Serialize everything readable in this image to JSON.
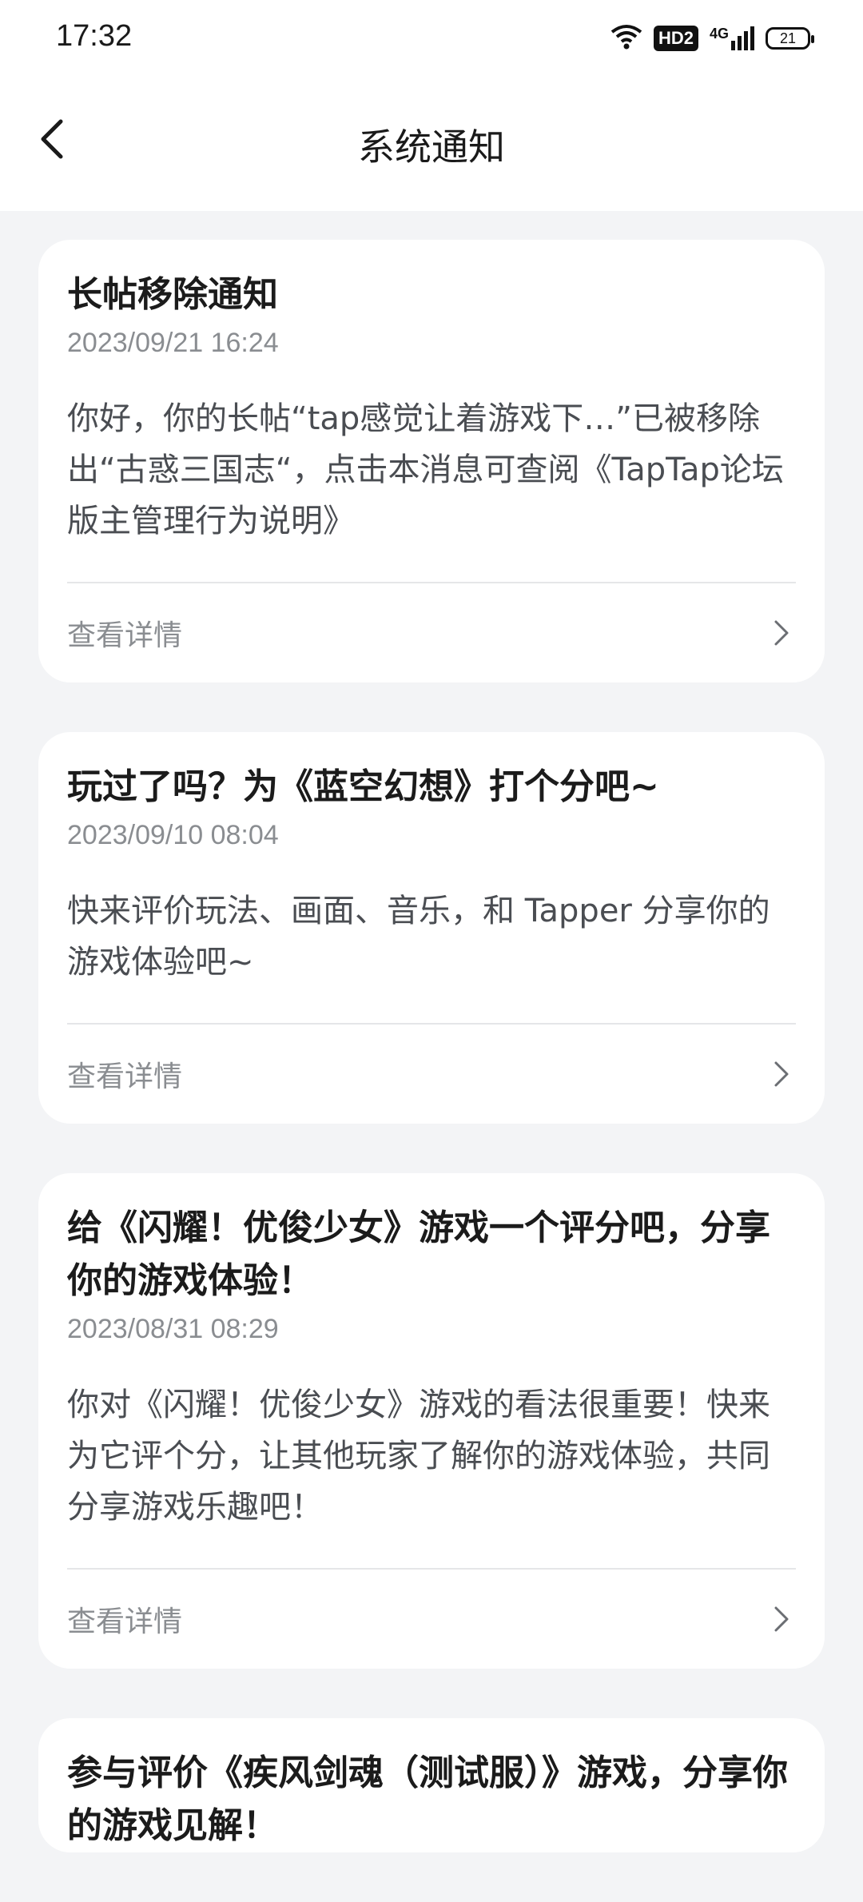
{
  "status": {
    "time": "17:32",
    "hd_label": "HD2",
    "network": "4G",
    "battery": "21"
  },
  "header": {
    "title": "系统通知"
  },
  "notifications": [
    {
      "title": "长帖移除通知",
      "date": "2023/09/21 16:24",
      "body": "你好，你的长帖“tap感觉让着游戏下…”已被移除出“古惑三国志“，点击本消息可查阅《TapTap论坛版主管理行为说明》",
      "detail_label": "查看详情"
    },
    {
      "title": "玩过了吗？为《蓝空幻想》打个分吧~",
      "date": "2023/09/10 08:04",
      "body": "快来评价玩法、画面、音乐，和 Tapper 分享你的游戏体验吧~",
      "detail_label": "查看详情"
    },
    {
      "title": "给《闪耀！优俊少女》游戏一个评分吧，分享你的游戏体验！",
      "date": "2023/08/31 08:29",
      "body": "你对《闪耀！优俊少女》游戏的看法很重要！快来为它评个分，让其他玩家了解你的游戏体验，共同分享游戏乐趣吧！",
      "detail_label": "查看详情"
    },
    {
      "title": "参与评价《疾风剑魂（测试服）》游戏，分享你的游戏见解！",
      "date": "",
      "body": "",
      "detail_label": ""
    }
  ]
}
